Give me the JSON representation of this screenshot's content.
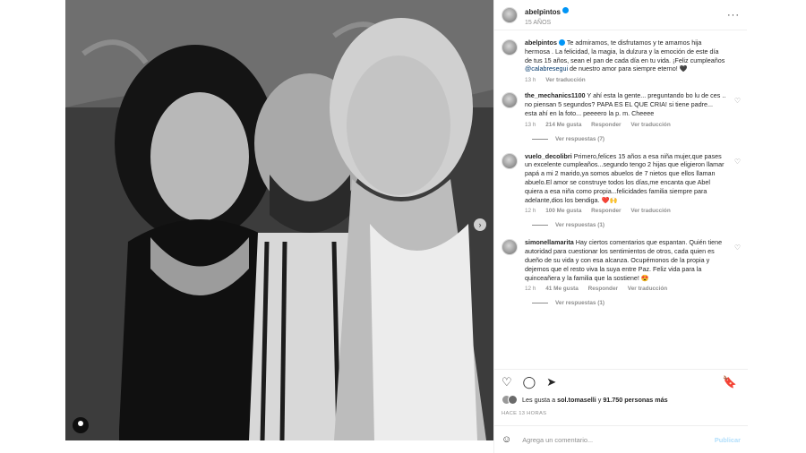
{
  "post": {
    "username": "abelpintos",
    "subtitle": "15 AÑOS",
    "more_glyph": "···"
  },
  "caption": {
    "username": "abelpintos",
    "text_before_mention": "Te admiramos, te disfrutamos y te amamos hija hermosa . La felicidad, la magia, la dulzura y la emoción de este día de tus 15 años, sean el pan de cada día en tu vida. ¡Feliz cumpleaños ",
    "mention": "@calabresegui",
    "text_after_mention": " de nuestro amor para siempre eterno! 🖤",
    "time": "13 h",
    "translate": "Ver traducción"
  },
  "comments": [
    {
      "username": "the_mechanics1100",
      "text": "Y ahí esta la gente... preguntando bo lu de ces .. no piensan 5 segundos? PAPA ES EL QUE CRIA! si tiene padre... esta ahí en la foto... peeeero la p. m. Cheeee",
      "time": "13 h",
      "likes": "214 Me gusta",
      "reply": "Responder",
      "translate": "Ver traducción",
      "replies": "Ver respuestas (7)"
    },
    {
      "username": "vuelo_decolibri",
      "text": "Primero,felices 15 años a esa niña mujer,que pases un excelente cumpleaños...segundo tengo 2 hijas que eligieron llamar papá a mi 2 marido,ya somos abuelos de 7 nietos que ellos llaman abuelo.El amor se construye todos los días,me encanta que Abel quiera a esa niña como propia...felicidades familia siempre para adelante,dios los bendiga. ❤️🙌",
      "time": "12 h",
      "likes": "100 Me gusta",
      "reply": "Responder",
      "translate": "Ver traducción",
      "replies": "Ver respuestas (1)"
    },
    {
      "username": "simonellamarita",
      "text": "Hay ciertos comentarios que espantan. Quién tiene autoridad para cuestionar los sentimientos de otros, cada quien es dueño de su vida y con esa alcanza. Ocupémonos de la propia y dejemos que el resto viva la suya entre Paz. Feliz vida para la quinceañera y la familia que la sostiene! 😍",
      "time": "12 h",
      "likes": "41 Me gusta",
      "reply": "Responder",
      "translate": "Ver traducción",
      "replies": "Ver respuestas (1)"
    }
  ],
  "actions": {
    "like_glyph": "♡",
    "comment_glyph": "◯",
    "share_glyph": "➤",
    "save_glyph": "🔖"
  },
  "likes": {
    "prefix": "Les gusta a ",
    "user": "sol.tomaselli",
    "middle": " y ",
    "count": "91.750 personas más"
  },
  "time_ago": "HACE 13 HORAS",
  "add_comment": {
    "placeholder": "Agrega un comentario...",
    "post_label": "Publicar",
    "emoji_glyph": "☺"
  },
  "icons": {
    "heart_small": "♡",
    "nav_next": "›"
  },
  "colors": {
    "link": "#00376b",
    "verified": "#0095f6",
    "post_button_disabled": "#b2dffc",
    "muted": "#8e8e8e"
  }
}
